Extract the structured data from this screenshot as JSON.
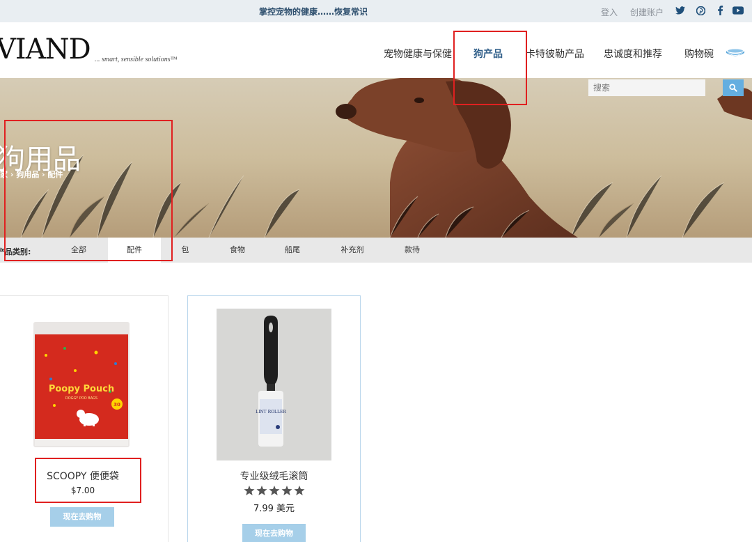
{
  "topbar": {
    "promo": "掌控宠物的健康……恢复常识",
    "login": "登入",
    "signup": "创建账户",
    "social": [
      "twitter-icon",
      "pinterest-icon",
      "facebook-icon",
      "youtube-icon"
    ]
  },
  "header": {
    "logo": "VIAND",
    "tagline": "... smart, sensible solutions™",
    "nav": [
      {
        "label": "宠物健康与保健"
      },
      {
        "label": "狗产品",
        "active": true
      },
      {
        "label": "卡特彼勒产品"
      },
      {
        "label": "忠诚度和推荐"
      },
      {
        "label": "购物碗"
      }
    ]
  },
  "hero": {
    "title": "狗用品",
    "breadcrumb": "家 › 狗用品 › 配件",
    "search_placeholder": "搜索"
  },
  "categories": {
    "label": "产品类别:",
    "items": [
      "全部",
      "配件",
      "包",
      "食物",
      "船尾",
      "补充剂",
      "款待"
    ],
    "active": "配件"
  },
  "products": [
    {
      "name": "SCOOPY 便便袋",
      "price": "$7.00",
      "button": "现在去购物",
      "package_text": "Poopy Pouch",
      "package_sub": "DOGGY POO BAGS",
      "badge": "30"
    },
    {
      "name": "专业级绒毛滚筒",
      "rating": 5,
      "price": "7.99 美元",
      "button": "现在去购物",
      "label_text": "LINT ROLLER"
    }
  ],
  "colors": {
    "accent": "#2e5d88",
    "button": "#a6cfe9",
    "search": "#64aee0",
    "annotation": "#e02020"
  }
}
